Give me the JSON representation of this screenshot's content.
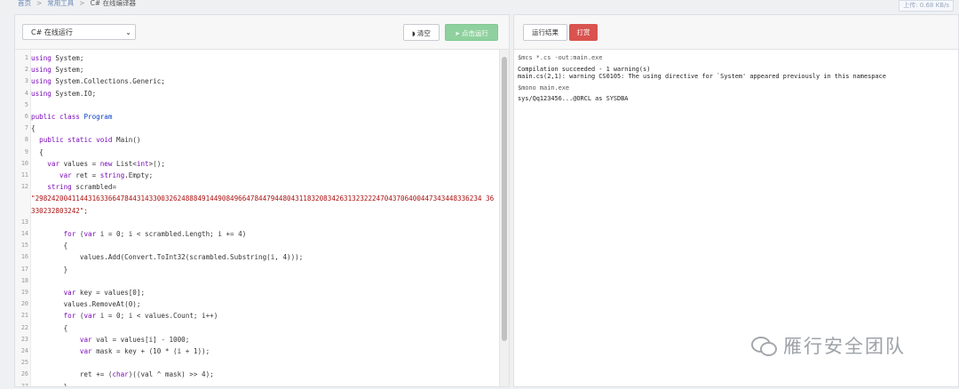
{
  "breadcrumb": {
    "home": "首页",
    "tools": "常用工具",
    "current": "C# 在线编译器",
    "sep": ">"
  },
  "speed_indicator": "上传: 0.68 KB/s",
  "left_toolbar": {
    "language_select": "C# 在线运行",
    "clear_button": "清空",
    "run_button": "点击运行"
  },
  "right_toolbar": {
    "result_tab": "运行结果",
    "reward_button": "打赏"
  },
  "editor": {
    "lines": [
      {
        "n": "1",
        "t": "using System;"
      },
      {
        "n": "2",
        "t": "using System;"
      },
      {
        "n": "3",
        "t": "using System.Collections.Generic;"
      },
      {
        "n": "4",
        "t": "using System.IO;"
      },
      {
        "n": "5",
        "t": ""
      },
      {
        "n": "6",
        "t": "public class Program"
      },
      {
        "n": "7",
        "t": "{"
      },
      {
        "n": "8",
        "t": "  public static void Main()"
      },
      {
        "n": "9",
        "t": "  {"
      },
      {
        "n": "10",
        "t": "    var values = new List<int>();"
      },
      {
        "n": "11",
        "t": "       var ret = string.Empty;"
      },
      {
        "n": "12",
        "t": "    string scrambled="
      },
      {
        "n": "",
        "t": "\"29824200411443163366478443143300326248884914490849664784479448043118320834263132322247043706400447343448336234 36"
      },
      {
        "n": "",
        "t": "330232803242\";"
      },
      {
        "n": "13",
        "t": ""
      },
      {
        "n": "14",
        "t": "        for (var i = 0; i < scrambled.Length; i += 4)"
      },
      {
        "n": "15",
        "t": "        {"
      },
      {
        "n": "16",
        "t": "            values.Add(Convert.ToInt32(scrambled.Substring(i, 4)));"
      },
      {
        "n": "17",
        "t": "        }"
      },
      {
        "n": "18",
        "t": ""
      },
      {
        "n": "19",
        "t": "        var key = values[0];"
      },
      {
        "n": "20",
        "t": "        values.RemoveAt(0);"
      },
      {
        "n": "21",
        "t": "        for (var i = 0; i < values.Count; i++)"
      },
      {
        "n": "22",
        "t": "        {"
      },
      {
        "n": "23",
        "t": "            var val = values[i] - 1000;"
      },
      {
        "n": "24",
        "t": "            var mask = key + (10 * (i + 1));"
      },
      {
        "n": "25",
        "t": ""
      },
      {
        "n": "26",
        "t": "            ret += (char)((val ^ mask) >> 4);"
      },
      {
        "n": "27",
        "t": "        }"
      }
    ]
  },
  "output": {
    "line1": "$mcs *.cs -out:main.exe",
    "line2": "Compilation succeeded - 1 warning(s)",
    "line3": "main.cs(2,1): warning CS0105: The using directive for `System' appeared previously in this namespace",
    "line4": "$mono main.exe",
    "line5": "sys/Qq123456...@ORCL as SYSDBA"
  },
  "watermark": {
    "text": "雁行安全团队",
    "icon": "wechat-icon"
  }
}
